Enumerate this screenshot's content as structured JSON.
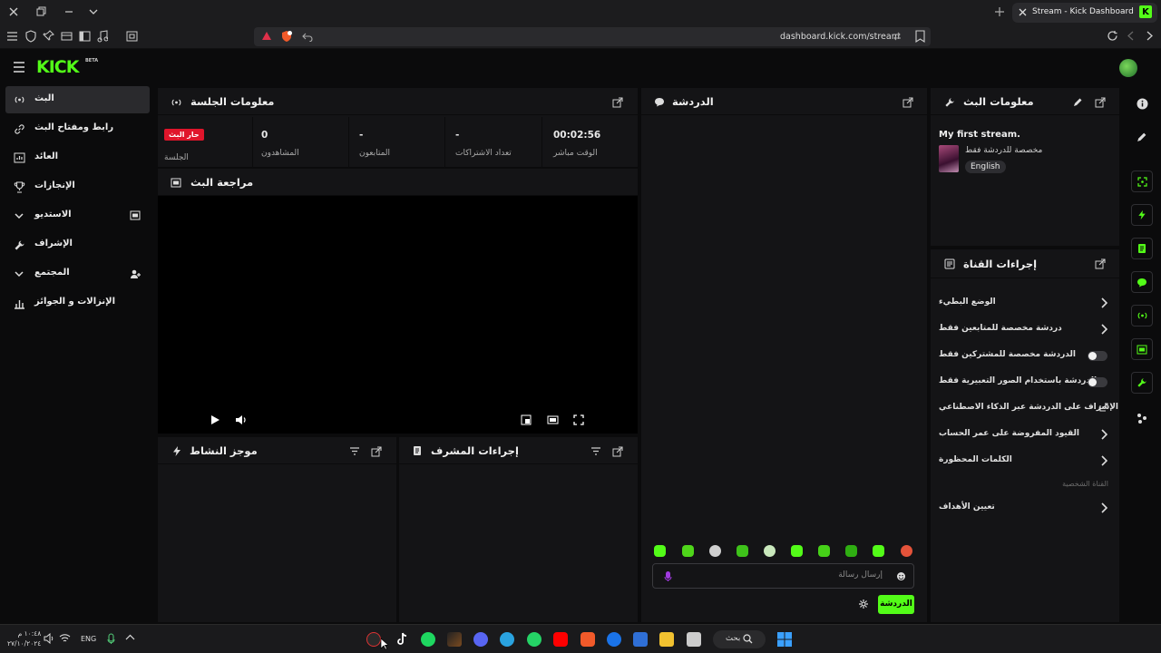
{
  "browser": {
    "tab_title": "Stream - Kick Dashboard",
    "url": "dashboard.kick.com/stream"
  },
  "app": {
    "logo": "KICK",
    "logo_badge": "BETA"
  },
  "sidebar": {
    "items": [
      {
        "label": "البث",
        "icon": "broadcast-icon"
      },
      {
        "label": "رابط ومفتاح البث",
        "icon": "link-icon"
      },
      {
        "label": "العائد",
        "icon": "revenue-icon"
      },
      {
        "label": "الإنجازات",
        "icon": "trophy-icon"
      },
      {
        "label": "الاستديو",
        "icon": "studio-icon"
      },
      {
        "label": "الإشراف",
        "icon": "wrench-icon"
      },
      {
        "label": "المجتمع",
        "icon": "community-icon"
      },
      {
        "label": "الإنزالات و الجوائز",
        "icon": "drops-icon"
      }
    ]
  },
  "session": {
    "title": "معلومات الجلسة",
    "live_badge": "حار البث",
    "session_label": "الجلسة",
    "viewers_value": "0",
    "viewers_label": "المشاهدون",
    "followers_value": "-",
    "followers_label": "المتابعون",
    "subs_value": "-",
    "subs_label": "تعداد الاشتراكات",
    "live_time_value": "00:02:56",
    "live_time_label": "الوقت مباشر"
  },
  "preview": {
    "title": "مراجعة البث"
  },
  "activity": {
    "title": "موجز النشاط"
  },
  "mod_actions": {
    "title": "إجراءات المشرف"
  },
  "chat": {
    "title": "الدردشة",
    "placeholder": "إرسال رسالة",
    "send_label": "الدردشة"
  },
  "stream_info": {
    "title": "معلومات البث",
    "stream_title": "My first stream.",
    "category": "مخصصة للدردشة فقط",
    "language": "English"
  },
  "channel_actions": {
    "title": "إجراءات القناة",
    "items": [
      {
        "label": "الوضع البطيء",
        "control": "chevron"
      },
      {
        "label": "دردشة مخصصة للمتابعين فقط",
        "control": "chevron"
      },
      {
        "label": "الدردشة مخصصة للمشتركين فقط",
        "control": "toggle"
      },
      {
        "label": "الدردشة باستخدام الصور التعبيرية فقط",
        "control": "toggle"
      },
      {
        "label": "الإشراف على الدردشة عبر الذكاء الاصطناعي",
        "control": "external"
      },
      {
        "label": "القيود المفروضة على عمر الحساب",
        "control": "chevron"
      },
      {
        "label": "الكلمات المحظورة",
        "control": "chevron"
      }
    ],
    "section_label": "القناة الشخصية",
    "goals_label": "تعيين الأهداف"
  },
  "taskbar": {
    "language": "ENG",
    "search_label": "بحث",
    "time": "١٠:٤٨ م",
    "date": "٢٧/١٠/٢٠٢٤"
  },
  "colors": {
    "accent": "#53fc18",
    "live": "#e0152b",
    "panel": "#141416",
    "background": "#0b0b0c"
  }
}
